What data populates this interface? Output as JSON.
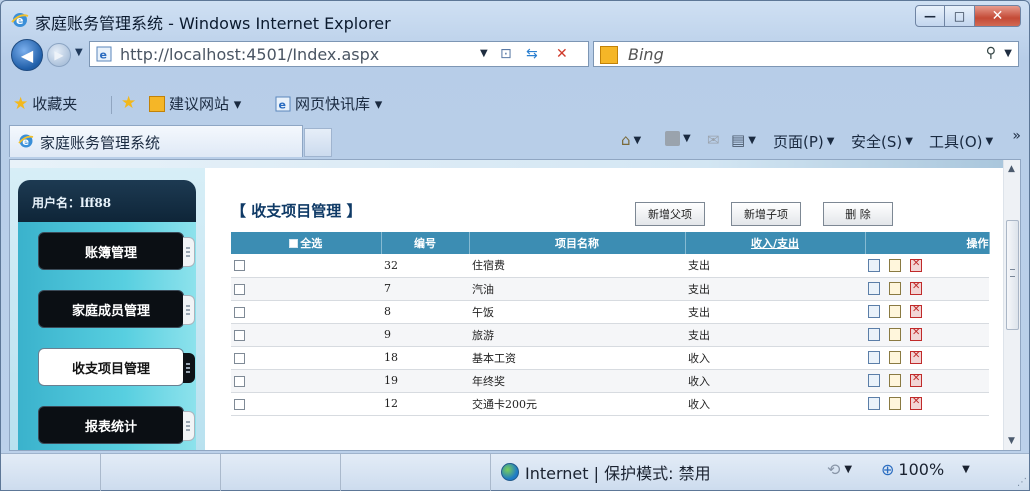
{
  "window": {
    "title": "家庭账务管理系统 - Windows Internet Explorer",
    "controls": {
      "minimize": "—",
      "maximize": "□",
      "close": "✕"
    }
  },
  "address_bar": {
    "url": "http://localhost:4501/Index.aspx",
    "search_placeholder": "Bing"
  },
  "favorites": {
    "label": "收藏夹",
    "items": [
      {
        "label": "建议网站 ▾"
      },
      {
        "label": "网页快讯库 ▾"
      }
    ]
  },
  "tab": {
    "title": "家庭账务管理系统"
  },
  "command_bar": {
    "page": "页面(P)",
    "safety": "安全(S)",
    "tools": "工具(O)"
  },
  "sidebar": {
    "user_label": "用户名：lff88",
    "menu": [
      {
        "label": "账簿管理"
      },
      {
        "label": "家庭成员管理"
      },
      {
        "label": "收支项目管理"
      },
      {
        "label": "报表统计"
      }
    ]
  },
  "main": {
    "title": "【 收支项目管理 】",
    "buttons": {
      "new_parent": "新增父项",
      "new_child": "新增子项",
      "delete": "删 除"
    },
    "table": {
      "columns": [
        "全选",
        "编号",
        "项目名称",
        "收入/支出",
        "操作"
      ],
      "rows": [
        {
          "id": "32",
          "name": "住宿费",
          "type": "支出"
        },
        {
          "id": "7",
          "name": "汽油",
          "type": "支出"
        },
        {
          "id": "8",
          "name": "午饭",
          "type": "支出"
        },
        {
          "id": "9",
          "name": "旅游",
          "type": "支出"
        },
        {
          "id": "18",
          "name": "基本工资",
          "type": "收入"
        },
        {
          "id": "19",
          "name": "年终奖",
          "type": "收入"
        },
        {
          "id": "12",
          "name": "交通卡200元",
          "type": "收入"
        }
      ]
    }
  },
  "status_bar": {
    "zone": "Internet | 保护模式: 禁用",
    "zoom": "100%"
  }
}
